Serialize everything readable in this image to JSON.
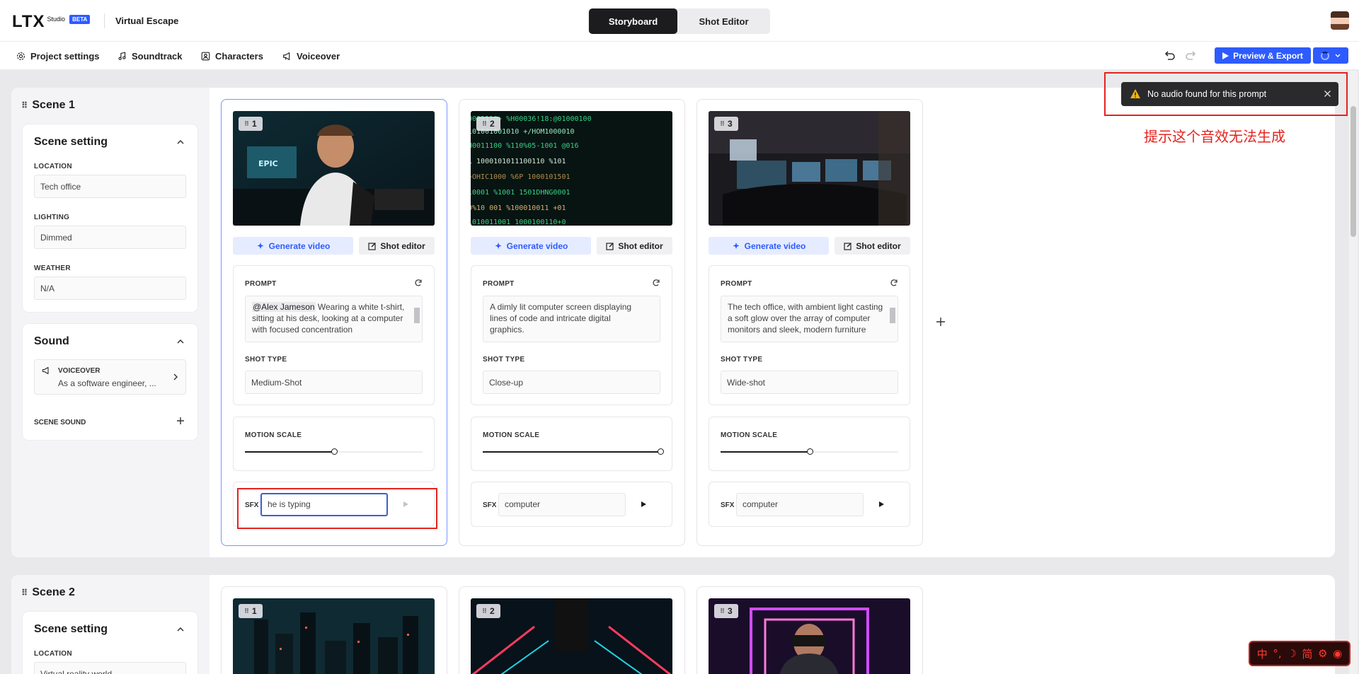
{
  "app": {
    "logo_text": "LTX",
    "logo_sub": "Studio",
    "beta": "BETA",
    "project_name": "Virtual Escape"
  },
  "modes": [
    "Storyboard",
    "Shot Editor"
  ],
  "subnav": {
    "project_settings": "Project settings",
    "soundtrack": "Soundtrack",
    "characters": "Characters",
    "voiceover": "Voiceover"
  },
  "export_label": "Preview & Export",
  "toast": {
    "message": "No audio found for this prompt"
  },
  "annotation_text": "提示这个音效无法生成",
  "ime": [
    "中",
    "°,",
    "☽",
    "简",
    "⚙",
    "◉"
  ],
  "scene1": {
    "title": "Scene 1",
    "setting_title": "Scene setting",
    "location_label": "LOCATION",
    "location": "Tech office",
    "lighting_label": "LIGHTING",
    "lighting": "Dimmed",
    "weather_label": "WEATHER",
    "weather": "N/A",
    "sound_title": "Sound",
    "voiceover_label": "VOICEOVER",
    "voiceover_text": "As a software engineer, ...",
    "scene_sound_label": "SCENE SOUND",
    "shots": [
      {
        "number": "1",
        "generate": "Generate video",
        "shot_editor": "Shot editor",
        "prompt_label": "PROMPT",
        "mention": "@Alex Jameson",
        "prompt": " Wearing a white t-shirt, sitting at his desk, looking at a computer with focused concentration",
        "shot_type_label": "SHOT TYPE",
        "shot_type": "Medium-Shot",
        "motion_label": "MOTION SCALE",
        "motion": 0.5,
        "sfx_label": "SFX",
        "sfx": "he is typing"
      },
      {
        "number": "2",
        "generate": "Generate video",
        "shot_editor": "Shot editor",
        "prompt_label": "PROMPT",
        "mention": "",
        "prompt": "A dimly lit computer screen displaying lines of code and intricate digital graphics.",
        "shot_type_label": "SHOT TYPE",
        "shot_type": "Close-up",
        "motion_label": "MOTION SCALE",
        "motion": 1.0,
        "sfx_label": "SFX",
        "sfx": "computer"
      },
      {
        "number": "3",
        "generate": "Generate video",
        "shot_editor": "Shot editor",
        "prompt_label": "PROMPT",
        "mention": "",
        "prompt": "The tech office, with ambient light casting a soft glow over the array of computer monitors and sleek, modern furniture",
        "shot_type_label": "SHOT TYPE",
        "shot_type": "Wide-shot",
        "motion_label": "MOTION SCALE",
        "motion": 0.5,
        "sfx_label": "SFX",
        "sfx": "computer"
      }
    ]
  },
  "scene2": {
    "title": "Scene 2",
    "setting_title": "Scene setting",
    "location_label": "LOCATION",
    "location": "Virtual reality world",
    "shots": [
      "1",
      "2",
      "3"
    ]
  }
}
